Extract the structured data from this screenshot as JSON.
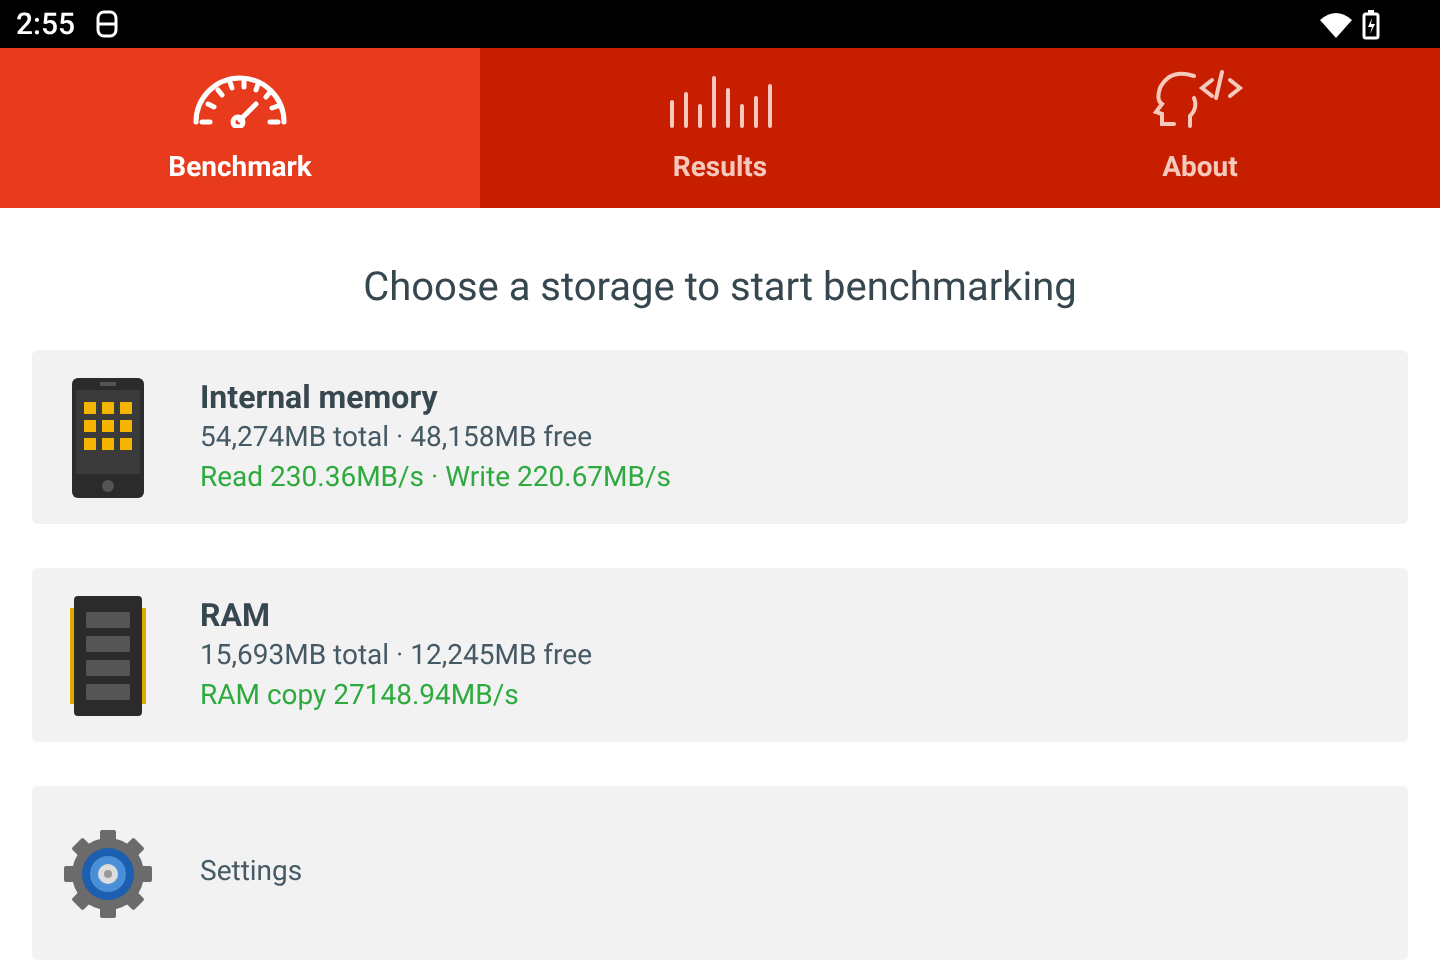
{
  "status_bar": {
    "time": "2:55"
  },
  "tabs": [
    {
      "label": "Benchmark",
      "selected": true
    },
    {
      "label": "Results",
      "selected": false
    },
    {
      "label": "About",
      "selected": false
    }
  ],
  "heading": "Choose a storage to start benchmarking",
  "items": [
    {
      "kind": "storage",
      "title": "Internal memory",
      "capacity": "54,274MB total · 48,158MB free",
      "speed": "Read 230.36MB/s · Write 220.67MB/s"
    },
    {
      "kind": "storage",
      "title": "RAM",
      "capacity": "15,693MB total · 12,245MB free",
      "speed": "RAM copy 27148.94MB/s"
    },
    {
      "kind": "settings",
      "title": "Settings"
    }
  ]
}
